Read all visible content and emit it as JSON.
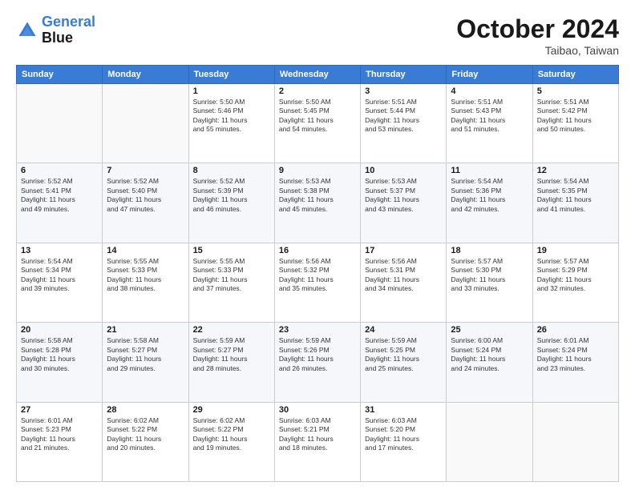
{
  "header": {
    "logo_general": "General",
    "logo_blue": "Blue",
    "month_title": "October 2024",
    "subtitle": "Taibao, Taiwan"
  },
  "weekdays": [
    "Sunday",
    "Monday",
    "Tuesday",
    "Wednesday",
    "Thursday",
    "Friday",
    "Saturday"
  ],
  "weeks": [
    [
      {
        "day": "",
        "info": ""
      },
      {
        "day": "",
        "info": ""
      },
      {
        "day": "1",
        "info": "Sunrise: 5:50 AM\nSunset: 5:46 PM\nDaylight: 11 hours\nand 55 minutes."
      },
      {
        "day": "2",
        "info": "Sunrise: 5:50 AM\nSunset: 5:45 PM\nDaylight: 11 hours\nand 54 minutes."
      },
      {
        "day": "3",
        "info": "Sunrise: 5:51 AM\nSunset: 5:44 PM\nDaylight: 11 hours\nand 53 minutes."
      },
      {
        "day": "4",
        "info": "Sunrise: 5:51 AM\nSunset: 5:43 PM\nDaylight: 11 hours\nand 51 minutes."
      },
      {
        "day": "5",
        "info": "Sunrise: 5:51 AM\nSunset: 5:42 PM\nDaylight: 11 hours\nand 50 minutes."
      }
    ],
    [
      {
        "day": "6",
        "info": "Sunrise: 5:52 AM\nSunset: 5:41 PM\nDaylight: 11 hours\nand 49 minutes."
      },
      {
        "day": "7",
        "info": "Sunrise: 5:52 AM\nSunset: 5:40 PM\nDaylight: 11 hours\nand 47 minutes."
      },
      {
        "day": "8",
        "info": "Sunrise: 5:52 AM\nSunset: 5:39 PM\nDaylight: 11 hours\nand 46 minutes."
      },
      {
        "day": "9",
        "info": "Sunrise: 5:53 AM\nSunset: 5:38 PM\nDaylight: 11 hours\nand 45 minutes."
      },
      {
        "day": "10",
        "info": "Sunrise: 5:53 AM\nSunset: 5:37 PM\nDaylight: 11 hours\nand 43 minutes."
      },
      {
        "day": "11",
        "info": "Sunrise: 5:54 AM\nSunset: 5:36 PM\nDaylight: 11 hours\nand 42 minutes."
      },
      {
        "day": "12",
        "info": "Sunrise: 5:54 AM\nSunset: 5:35 PM\nDaylight: 11 hours\nand 41 minutes."
      }
    ],
    [
      {
        "day": "13",
        "info": "Sunrise: 5:54 AM\nSunset: 5:34 PM\nDaylight: 11 hours\nand 39 minutes."
      },
      {
        "day": "14",
        "info": "Sunrise: 5:55 AM\nSunset: 5:33 PM\nDaylight: 11 hours\nand 38 minutes."
      },
      {
        "day": "15",
        "info": "Sunrise: 5:55 AM\nSunset: 5:33 PM\nDaylight: 11 hours\nand 37 minutes."
      },
      {
        "day": "16",
        "info": "Sunrise: 5:56 AM\nSunset: 5:32 PM\nDaylight: 11 hours\nand 35 minutes."
      },
      {
        "day": "17",
        "info": "Sunrise: 5:56 AM\nSunset: 5:31 PM\nDaylight: 11 hours\nand 34 minutes."
      },
      {
        "day": "18",
        "info": "Sunrise: 5:57 AM\nSunset: 5:30 PM\nDaylight: 11 hours\nand 33 minutes."
      },
      {
        "day": "19",
        "info": "Sunrise: 5:57 AM\nSunset: 5:29 PM\nDaylight: 11 hours\nand 32 minutes."
      }
    ],
    [
      {
        "day": "20",
        "info": "Sunrise: 5:58 AM\nSunset: 5:28 PM\nDaylight: 11 hours\nand 30 minutes."
      },
      {
        "day": "21",
        "info": "Sunrise: 5:58 AM\nSunset: 5:27 PM\nDaylight: 11 hours\nand 29 minutes."
      },
      {
        "day": "22",
        "info": "Sunrise: 5:59 AM\nSunset: 5:27 PM\nDaylight: 11 hours\nand 28 minutes."
      },
      {
        "day": "23",
        "info": "Sunrise: 5:59 AM\nSunset: 5:26 PM\nDaylight: 11 hours\nand 26 minutes."
      },
      {
        "day": "24",
        "info": "Sunrise: 5:59 AM\nSunset: 5:25 PM\nDaylight: 11 hours\nand 25 minutes."
      },
      {
        "day": "25",
        "info": "Sunrise: 6:00 AM\nSunset: 5:24 PM\nDaylight: 11 hours\nand 24 minutes."
      },
      {
        "day": "26",
        "info": "Sunrise: 6:01 AM\nSunset: 5:24 PM\nDaylight: 11 hours\nand 23 minutes."
      }
    ],
    [
      {
        "day": "27",
        "info": "Sunrise: 6:01 AM\nSunset: 5:23 PM\nDaylight: 11 hours\nand 21 minutes."
      },
      {
        "day": "28",
        "info": "Sunrise: 6:02 AM\nSunset: 5:22 PM\nDaylight: 11 hours\nand 20 minutes."
      },
      {
        "day": "29",
        "info": "Sunrise: 6:02 AM\nSunset: 5:22 PM\nDaylight: 11 hours\nand 19 minutes."
      },
      {
        "day": "30",
        "info": "Sunrise: 6:03 AM\nSunset: 5:21 PM\nDaylight: 11 hours\nand 18 minutes."
      },
      {
        "day": "31",
        "info": "Sunrise: 6:03 AM\nSunset: 5:20 PM\nDaylight: 11 hours\nand 17 minutes."
      },
      {
        "day": "",
        "info": ""
      },
      {
        "day": "",
        "info": ""
      }
    ]
  ]
}
